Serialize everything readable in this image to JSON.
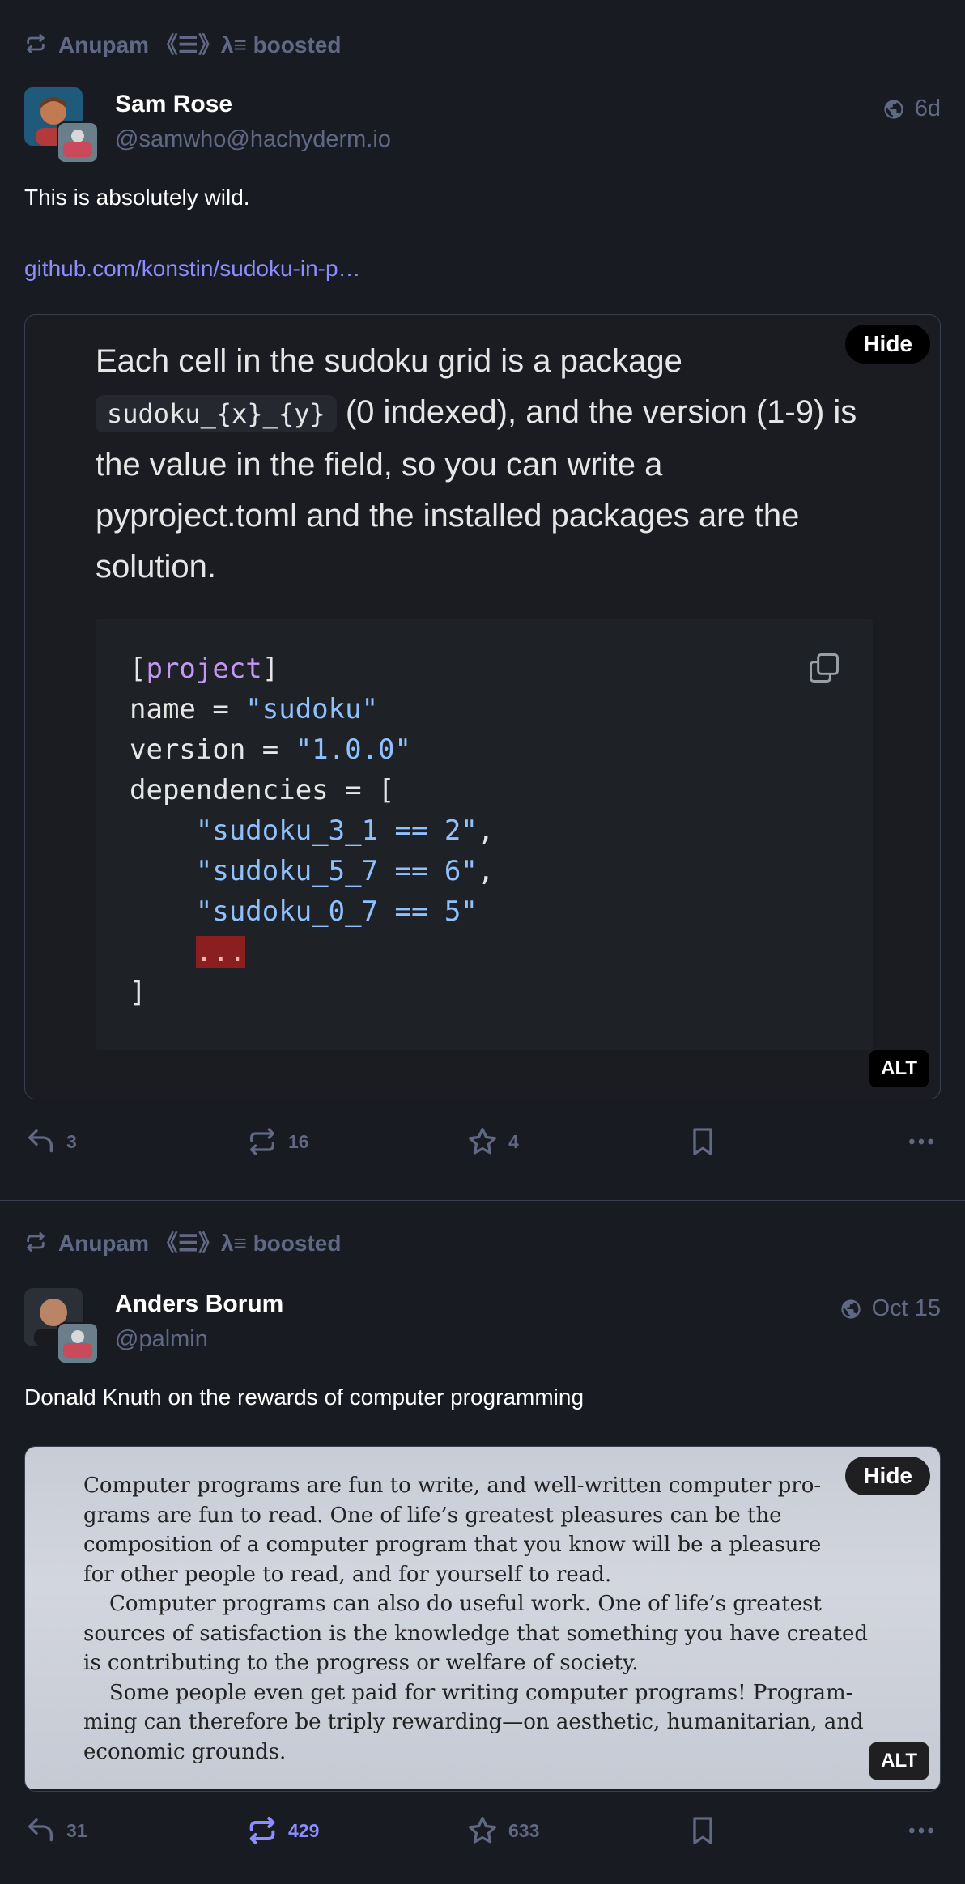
{
  "posts": [
    {
      "booster": "Anupam 《☰》λ≡ boosted",
      "author": {
        "display_name": "Sam Rose",
        "handle": "@samwho@hachyderm.io"
      },
      "time": "6d",
      "text": "This is absolutely wild.",
      "link": "github.com/konstin/sudoku-in-p…",
      "media": {
        "hide_label": "Hide",
        "alt_label": "ALT",
        "paragraph_before": "Each cell in the sudoku grid is a package",
        "inline_code": "sudoku_{x}_{y}",
        "paragraph_after": "(0 indexed), and the version (1-9) is the value in the field, so you can write a pyproject.toml and the installed packages are the solution.",
        "code": {
          "l1_open": "[",
          "l1_kw": "project",
          "l1_close": "]",
          "l2_key": "name = ",
          "l2_val": "\"sudoku\"",
          "l3_key": "version = ",
          "l3_val": "\"1.0.0\"",
          "l4": "dependencies = [",
          "l5_val": "\"sudoku_3_1 == 2\"",
          "l5_end": ",",
          "l6_val": "\"sudoku_5_7 == 6\"",
          "l6_end": ",",
          "l7_val": "\"sudoku_0_7 == 5\"",
          "l8": "...",
          "l9": "]"
        }
      },
      "actions": {
        "replies": "3",
        "boosts": "16",
        "favourites": "4"
      }
    },
    {
      "booster": "Anupam 《☰》λ≡ boosted",
      "author": {
        "display_name": "Anders Borum",
        "handle": "@palmin"
      },
      "time": "Oct 15",
      "text": "Donald Knuth on the rewards of computer programming",
      "media": {
        "hide_label": "Hide",
        "alt_label": "ALT",
        "paper_lines": [
          "Computer programs are fun to write, and well-written computer pro-",
          "grams are fun to read.  One of life’s greatest pleasures can be the",
          "composition of a computer program that you know will be a pleasure",
          "for other people to read, and for yourself to read.",
          "Computer programs can also do useful work.  One of life’s greatest",
          "sources of satisfaction is the knowledge that something you have created",
          "is contributing to the progress or welfare of society.",
          "Some people even get paid for writing computer programs! Program-",
          "ming can therefore be triply rewarding—on aesthetic, humanitarian, and",
          "economic grounds."
        ]
      },
      "actions": {
        "replies": "31",
        "boosts": "429",
        "favourites": "633"
      }
    }
  ],
  "colors": {
    "background": "#191b22",
    "muted": "#606984",
    "accent": "#8c8dff"
  }
}
